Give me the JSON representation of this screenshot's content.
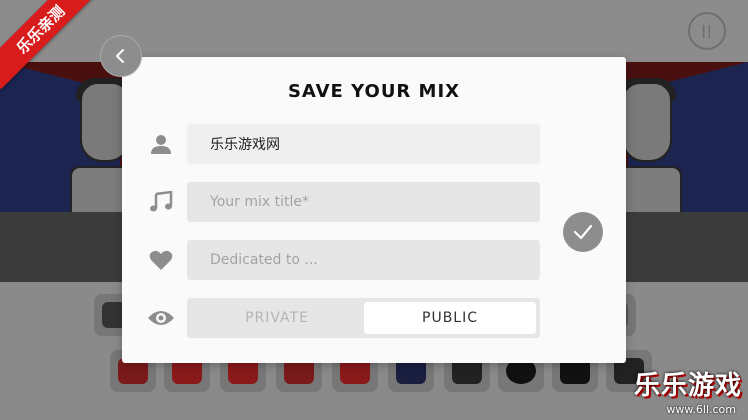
{
  "dialog": {
    "title": "SAVE YOUR MIX",
    "name_value": "乐乐游戏网",
    "title_placeholder": "Your mix title*",
    "dedicated_placeholder": "Dedicated to ...",
    "visibility": {
      "private_label": "PRIVATE",
      "public_label": "PUBLIC",
      "selected": "PUBLIC"
    }
  },
  "icons": {
    "back": "chevron-left-icon",
    "confirm": "checkmark-icon",
    "user": "user-icon",
    "music": "music-note-icon",
    "heart": "heart-icon",
    "eye": "eye-icon",
    "pause": "pause-icon"
  },
  "watermark": {
    "ribbon": "乐乐亲测",
    "site": "乐乐游戏",
    "url": "www.6ll.com"
  },
  "colors": {
    "dialog_bg": "#fafafa",
    "button_gray": "#8d8d8d",
    "field_bg": "#e6e6e6",
    "ribbon_red": "#d81c1c"
  }
}
